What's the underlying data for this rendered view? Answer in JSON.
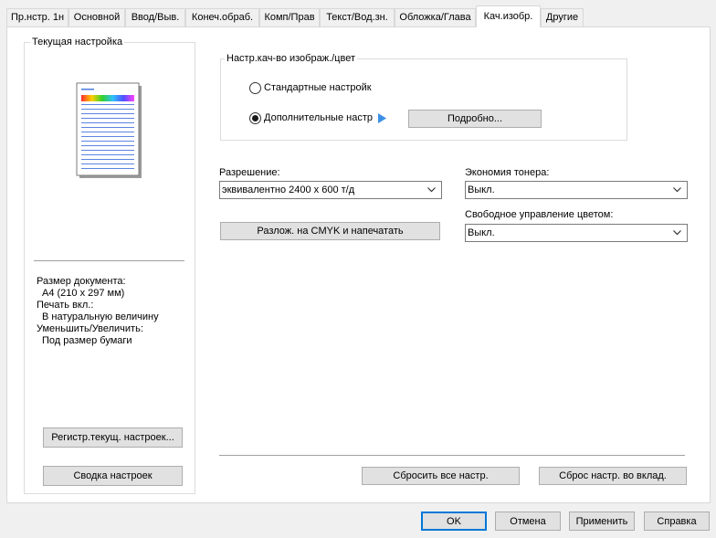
{
  "tabs": [
    {
      "label": "Пр.нстр. 1н"
    },
    {
      "label": "Основной"
    },
    {
      "label": "Ввод/Выв."
    },
    {
      "label": "Конеч.обраб."
    },
    {
      "label": "Комп/Прав"
    },
    {
      "label": "Текст/Вод.зн."
    },
    {
      "label": "Обложка/Глава"
    },
    {
      "label": "Кач.изобр."
    },
    {
      "label": "Другие"
    }
  ],
  "active_tab": "Кач.изобр.",
  "left_panel": {
    "title": "Текущая настройка",
    "info": [
      {
        "label": "Размер документа:",
        "value": "A4 (210 x 297 мм)"
      },
      {
        "label": "Печать вкл.:",
        "value": "В натуральную величину"
      },
      {
        "label": "Уменьшить/Увеличить:",
        "value": "Под размер бумаги"
      }
    ],
    "register_button": "Регистр.текущ. настроек...",
    "summary_button": "Сводка настроек"
  },
  "quality_group": {
    "title": "Настр.кач-во изображ./цвет",
    "radio_standard": "Стандартные настройк",
    "radio_advanced": "Дополнительные настр",
    "selected": "advanced",
    "details_button": "Подробно..."
  },
  "resolution": {
    "label": "Разрешение:",
    "value": "эквивалентно 2400 x 600 т/д"
  },
  "toner_saving": {
    "label": "Экономия тонера:",
    "value": "Выкл."
  },
  "cmyk_button": "Разлож. на CMYK и напечатать",
  "color_management": {
    "label": "Свободное управление цветом:",
    "value": "Выкл."
  },
  "reset_all_button": "Сбросить все настр.",
  "reset_tab_button": "Сброс настр. во вклад.",
  "dialog_buttons": {
    "ok": "OK",
    "cancel": "Отмена",
    "apply": "Применить",
    "help": "Справка"
  },
  "colors": {
    "accent": "#0078d7",
    "play_arrow": "#3c8fe6"
  }
}
